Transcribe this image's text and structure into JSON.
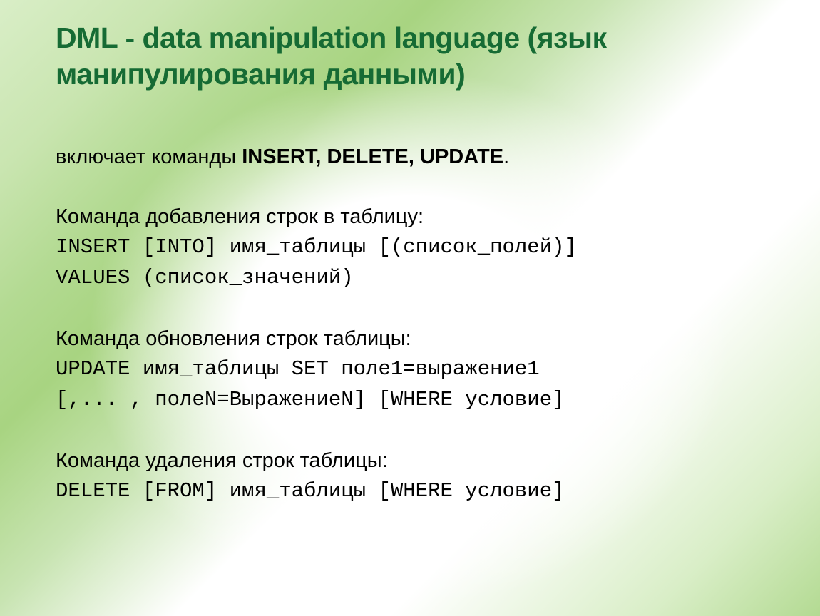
{
  "title": "DML - data manipulation language (язык манипулирования данными)",
  "intro_prefix": "включает команды ",
  "intro_bold": "INSERT, DELETE, UPDATE",
  "intro_suffix": ".",
  "section1": {
    "heading": "Команда добавления строк в таблицу:",
    "code1": "INSERT [INTO] имя_таблицы [(список_полей)]",
    "code2": "      VALUES (список_значений)"
  },
  "section2": {
    "heading": "Команда обновления строк таблицы:",
    "code1": "UPDATE имя_таблицы SET поле1=выражение1",
    "code2": "[,... , полеN=ВыражениеN] [WHERE условие]"
  },
  "section3": {
    "heading": "Команда удаления строк таблицы:",
    "code1": "DELETE [FROM] имя_таблицы [WHERE условие]"
  }
}
